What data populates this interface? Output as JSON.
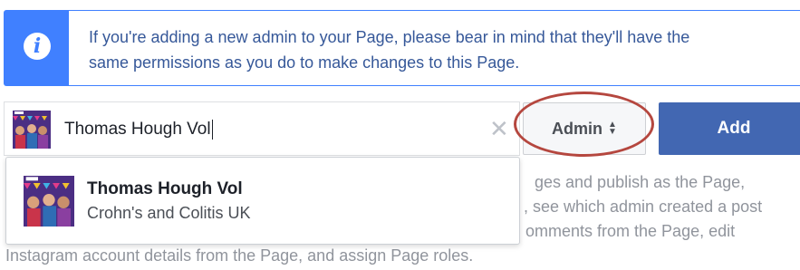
{
  "banner": {
    "icon": "info-icon",
    "line1": "If you're adding a new admin to your Page, please bear in mind that they'll have the",
    "line2": "same permissions as you do to make changes to this Page.",
    "color": "#4080ff"
  },
  "search": {
    "value": "Thomas Hough Vol",
    "clear_icon": "close-icon"
  },
  "role_select": {
    "selected": "Admin",
    "icon": "sort-arrows-icon"
  },
  "add_button": {
    "label": "Add",
    "color": "#4267b2"
  },
  "description": {
    "line1": "ges and publish as the Page,",
    "line2": ", see which admin created a post",
    "line3": "omments from the Page, edit",
    "line4": "Instagram account details from the Page, and assign Page roles."
  },
  "suggestions": [
    {
      "name": "Thomas Hough Vol",
      "subtitle": "Crohn's and Colitis UK"
    }
  ],
  "highlight_color": "#b5473f"
}
